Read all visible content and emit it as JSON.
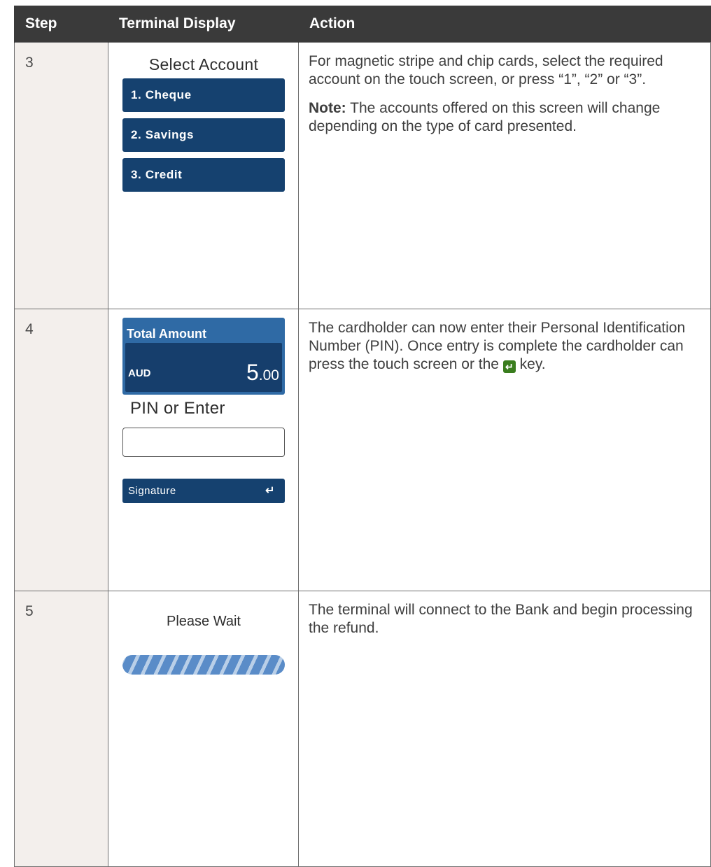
{
  "table": {
    "headers": {
      "step": "Step",
      "terminal": "Terminal Display",
      "action": "Action"
    },
    "rows": [
      {
        "step": "3",
        "terminal": {
          "title": "Select Account",
          "buttons": [
            "1. Cheque",
            "2. Savings",
            "3. Credit"
          ]
        },
        "action": {
          "text": "For magnetic stripe and chip cards, select the required account on the touch screen, or press “1”, “2” or “3”.",
          "note_label": "Note:",
          "note_text": " The accounts offered on this screen will change depending on the type of card presented."
        }
      },
      {
        "step": "4",
        "terminal": {
          "amount_label": "Total Amount",
          "currency": "AUD",
          "amount_whole": "5",
          "amount_cents": ".00",
          "pin_title": "PIN or Enter",
          "signature_label": "Signature",
          "signature_icon": "enter-key-icon"
        },
        "action": {
          "text_before_icon": "The cardholder can now enter their Personal Identification Number (PIN). Once entry is complete the cardholder can press the touch screen or the ",
          "icon": "enter-key-icon",
          "text_after_icon": " key."
        }
      },
      {
        "step": "5",
        "terminal": {
          "title": "Please Wait",
          "progress_indicator": "indeterminate-striped"
        },
        "action": {
          "text": "The terminal will connect to the Bank and begin processing the refund."
        }
      }
    ]
  },
  "colors": {
    "header_bg": "#3a3a3a",
    "step_col_bg": "#f3efec",
    "terminal_button": "#15416f",
    "amount_box": "#2f6aa5",
    "progress_stripe": "#5a8cc8",
    "enter_key": "#3a7d1e"
  }
}
